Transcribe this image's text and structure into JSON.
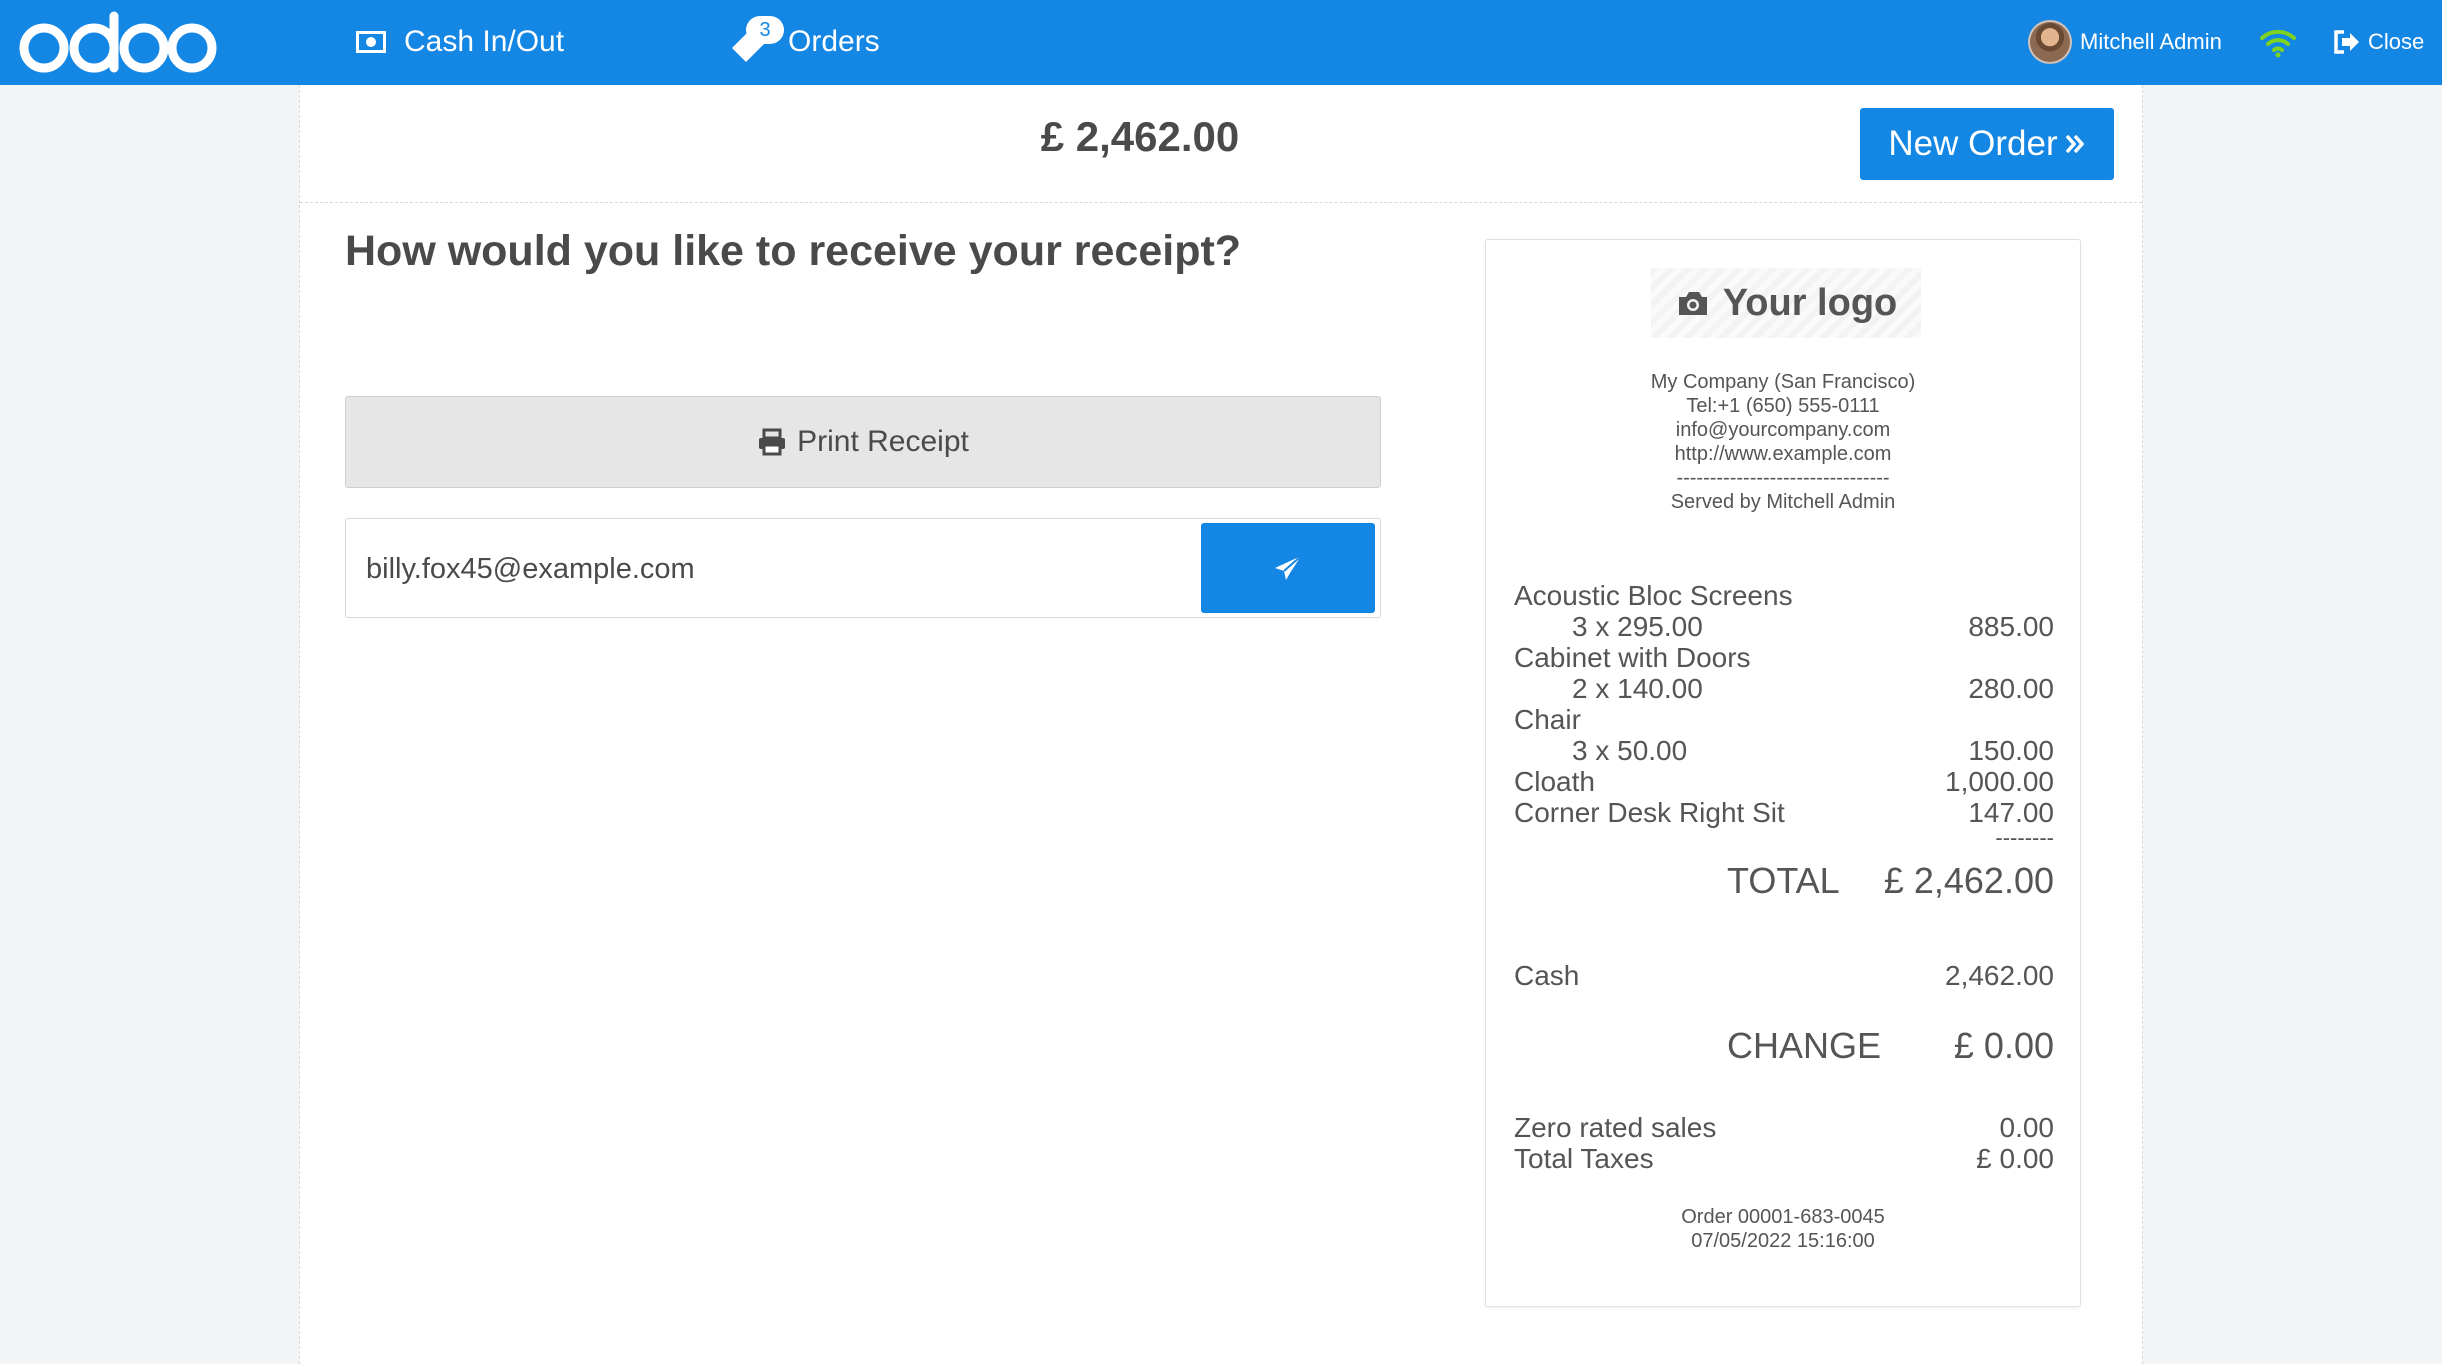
{
  "topbar": {
    "logo_text": "odoo",
    "cash_label": "Cash In/Out",
    "orders_label": "Orders",
    "orders_badge": "3",
    "user_name": "Mitchell Admin",
    "close_label": "Close"
  },
  "screen": {
    "amount": "£ 2,462.00",
    "new_order_label": "New Order",
    "question": "How would you like to receive your receipt?",
    "print_label": "Print Receipt",
    "email_value": "billy.fox45@example.com"
  },
  "receipt": {
    "logo_text": "Your logo",
    "company": "My Company (San Francisco)",
    "tel": "Tel:+1 (650) 555-0111",
    "email": "info@yourcompany.com",
    "website": "http://www.example.com",
    "separator": "--------------------------------",
    "served_by": "Served by Mitchell Admin",
    "lines": [
      {
        "name": "Acoustic Bloc Screens",
        "qty": "3 x 295.00",
        "amount": "885.00"
      },
      {
        "name": "Cabinet with Doors",
        "qty": "2 x 140.00",
        "amount": "280.00"
      },
      {
        "name": "Chair",
        "qty": "3 x 50.00",
        "amount": "150.00"
      },
      {
        "name": "Cloath",
        "qty": "",
        "amount": "1,000.00"
      },
      {
        "name": "Corner Desk Right Sit",
        "qty": "",
        "amount": "147.00"
      }
    ],
    "dashes": "--------",
    "total_label": "TOTAL",
    "total_value": "£ 2,462.00",
    "payment_label": "Cash",
    "payment_value": "2,462.00",
    "change_label": "CHANGE",
    "change_value": "£ 0.00",
    "zero_rated_label": "Zero rated sales",
    "zero_rated_value": "0.00",
    "taxes_label": "Total Taxes",
    "taxes_value": "£ 0.00",
    "order_ref": "Order 00001-683-0045",
    "order_date": "07/05/2022 15:16:00"
  },
  "colors": {
    "brand": "#1486e3",
    "wifi": "#7ed321"
  }
}
